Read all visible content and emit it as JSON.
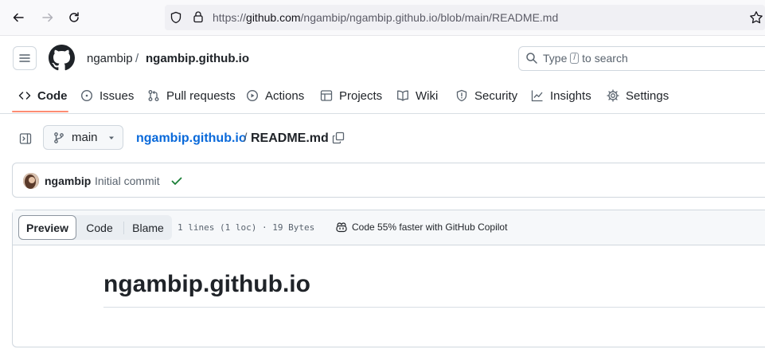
{
  "browser": {
    "url_prefix": "https://",
    "url_domain": "github.com",
    "url_path": "/ngambip/ngambip.github.io/blob/main/README.md"
  },
  "header": {
    "owner": "ngambip",
    "separator": "/",
    "repo": "ngambip.github.io",
    "search_before": "Type",
    "search_key": "/",
    "search_after": "to search"
  },
  "tabs": [
    {
      "label": "Code",
      "icon": "code-icon",
      "active": true
    },
    {
      "label": "Issues",
      "icon": "issue-icon"
    },
    {
      "label": "Pull requests",
      "icon": "pull-request-icon"
    },
    {
      "label": "Actions",
      "icon": "play-icon"
    },
    {
      "label": "Projects",
      "icon": "table-icon"
    },
    {
      "label": "Wiki",
      "icon": "book-icon"
    },
    {
      "label": "Security",
      "icon": "shield-icon"
    },
    {
      "label": "Insights",
      "icon": "graph-icon"
    },
    {
      "label": "Settings",
      "icon": "gear-icon"
    }
  ],
  "file_nav": {
    "branch": "main",
    "repo_link": "ngambip.github.io",
    "separator": "/",
    "file_name": "README.md"
  },
  "commit": {
    "author": "ngambip",
    "message": "Initial commit"
  },
  "viewer": {
    "modes": [
      "Preview",
      "Code",
      "Blame"
    ],
    "active_mode": "Preview",
    "meta": "1 lines (1 loc) · 19 Bytes",
    "copilot": "Code 55% faster with GitHub Copilot"
  },
  "readme": {
    "heading": "ngambip.github.io"
  },
  "colors": {
    "link": "#0969da",
    "tab_underline": "#fd8c73",
    "success": "#1a7f37"
  }
}
